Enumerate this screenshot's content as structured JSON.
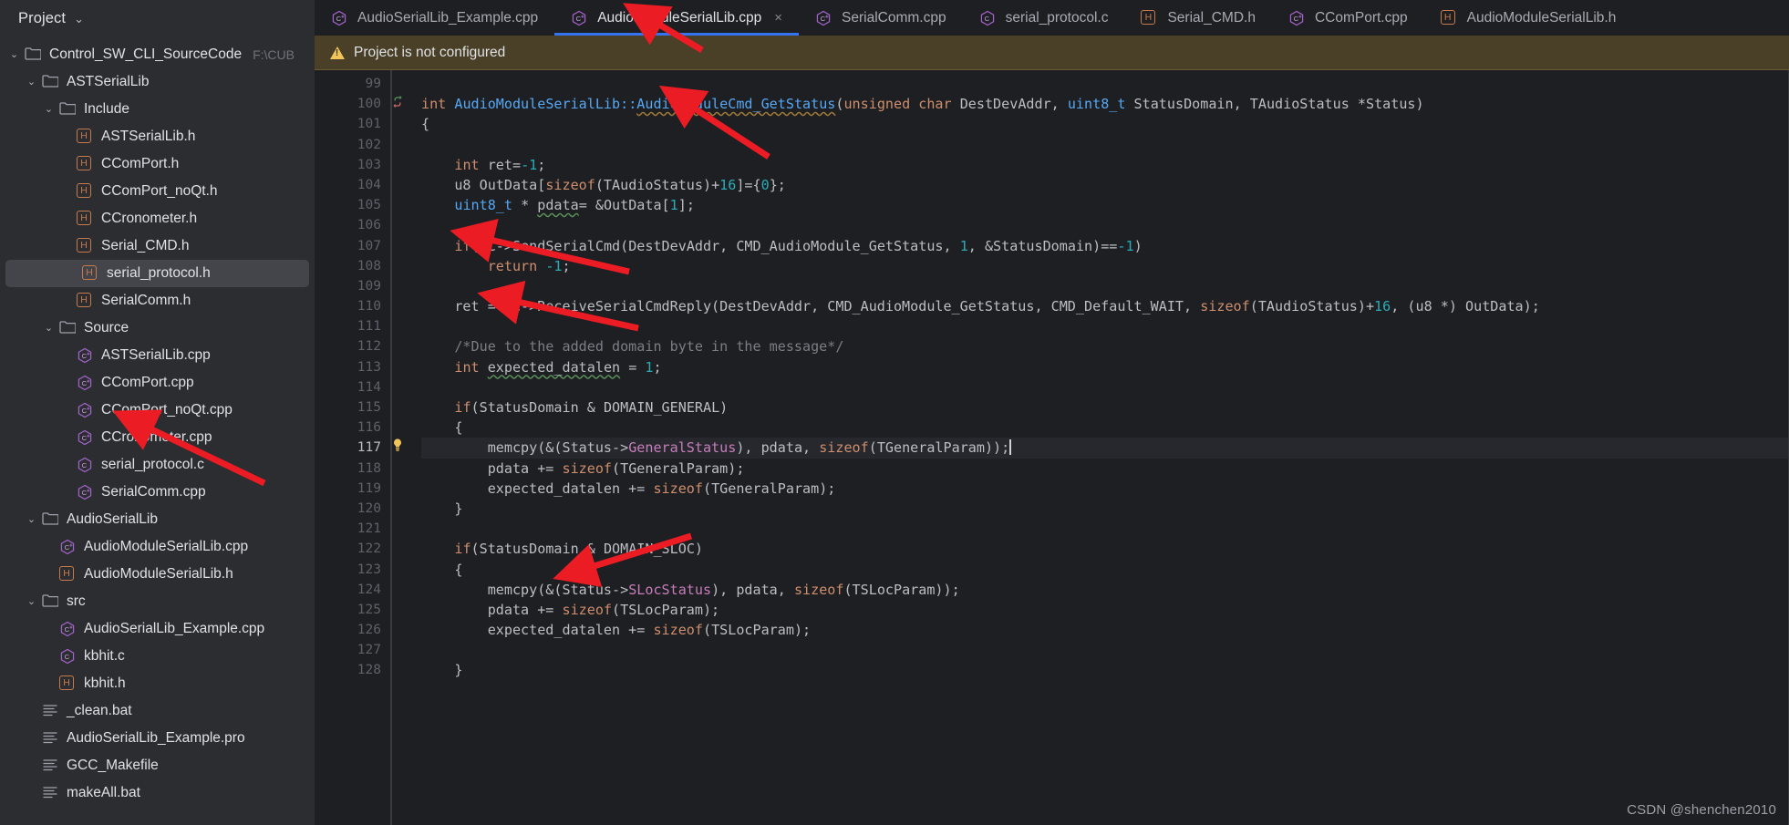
{
  "sidebar": {
    "title": "Project",
    "chevron": "⌄",
    "root_path": "F:\\CUB",
    "items": [
      {
        "label": "Control_SW_CLI_SourceCode",
        "icon": "folder-icon",
        "depth": 0,
        "twist": "⌄",
        "path": "F:\\CUB"
      },
      {
        "label": "ASTSerialLib",
        "icon": "folder-icon",
        "depth": 1,
        "twist": "⌄"
      },
      {
        "label": "Include",
        "icon": "folder-icon",
        "depth": 2,
        "twist": "⌄"
      },
      {
        "label": "ASTSerialLib.h",
        "icon": "header-file-icon",
        "depth": 3,
        "twist": ""
      },
      {
        "label": "CComPort.h",
        "icon": "header-file-icon",
        "depth": 3,
        "twist": ""
      },
      {
        "label": "CComPort_noQt.h",
        "icon": "header-file-icon",
        "depth": 3,
        "twist": ""
      },
      {
        "label": "CCronometer.h",
        "icon": "header-file-icon",
        "depth": 3,
        "twist": ""
      },
      {
        "label": "Serial_CMD.h",
        "icon": "header-file-icon",
        "depth": 3,
        "twist": ""
      },
      {
        "label": "serial_protocol.h",
        "icon": "header-file-icon",
        "depth": 3,
        "twist": "",
        "selected": true
      },
      {
        "label": "SerialComm.h",
        "icon": "header-file-icon",
        "depth": 3,
        "twist": ""
      },
      {
        "label": "Source",
        "icon": "folder-icon",
        "depth": 2,
        "twist": "⌄"
      },
      {
        "label": "ASTSerialLib.cpp",
        "icon": "cpp-file-icon",
        "depth": 3,
        "twist": ""
      },
      {
        "label": "CComPort.cpp",
        "icon": "cpp-file-icon",
        "depth": 3,
        "twist": ""
      },
      {
        "label": "CComPort_noQt.cpp",
        "icon": "cpp-file-icon",
        "depth": 3,
        "twist": ""
      },
      {
        "label": "CCronometer.cpp",
        "icon": "cpp-file-icon",
        "depth": 3,
        "twist": ""
      },
      {
        "label": "serial_protocol.c",
        "icon": "c-file-icon",
        "depth": 3,
        "twist": ""
      },
      {
        "label": "SerialComm.cpp",
        "icon": "cpp-file-icon",
        "depth": 3,
        "twist": ""
      },
      {
        "label": "AudioSerialLib",
        "icon": "folder-icon",
        "depth": 1,
        "twist": "⌄"
      },
      {
        "label": "AudioModuleSerialLib.cpp",
        "icon": "cpp-file-icon",
        "depth": 2,
        "twist": ""
      },
      {
        "label": "AudioModuleSerialLib.h",
        "icon": "header-file-icon",
        "depth": 2,
        "twist": ""
      },
      {
        "label": "src",
        "icon": "folder-icon",
        "depth": 1,
        "twist": "⌄"
      },
      {
        "label": "AudioSerialLib_Example.cpp",
        "icon": "cpp-file-icon",
        "depth": 2,
        "twist": ""
      },
      {
        "label": "kbhit.c",
        "icon": "c-file-icon",
        "depth": 2,
        "twist": ""
      },
      {
        "label": "kbhit.h",
        "icon": "header-file-icon",
        "depth": 2,
        "twist": ""
      },
      {
        "label": "_clean.bat",
        "icon": "text-file-icon",
        "depth": 1,
        "twist": ""
      },
      {
        "label": "AudioSerialLib_Example.pro",
        "icon": "text-file-icon",
        "depth": 1,
        "twist": ""
      },
      {
        "label": "GCC_Makefile",
        "icon": "text-file-icon",
        "depth": 1,
        "twist": ""
      },
      {
        "label": "makeAll.bat",
        "icon": "text-file-icon",
        "depth": 1,
        "twist": ""
      }
    ]
  },
  "tabs": [
    {
      "label": "AudioSerialLib_Example.cpp",
      "icon": "cpp-file-icon",
      "active": false
    },
    {
      "label": "AudioModuleSerialLib.cpp",
      "icon": "cpp-file-icon",
      "active": true,
      "close": "×"
    },
    {
      "label": "SerialComm.cpp",
      "icon": "cpp-file-icon",
      "active": false
    },
    {
      "label": "serial_protocol.c",
      "icon": "c-file-icon",
      "active": false
    },
    {
      "label": "Serial_CMD.h",
      "icon": "header-file-icon",
      "active": false
    },
    {
      "label": "CComPort.cpp",
      "icon": "cpp-file-icon",
      "active": false
    },
    {
      "label": "AudioModuleSerialLib.h",
      "icon": "header-file-icon",
      "active": false
    }
  ],
  "notification": {
    "icon": "warning-triangle-icon",
    "text": "Project is not configured"
  },
  "editor": {
    "first_line": 99,
    "current_line": 117,
    "lines": [
      {
        "n": 99,
        "tokens": []
      },
      {
        "n": 100,
        "marker": "method-return-icon",
        "tokens": [
          {
            "t": "int ",
            "c": "kw"
          },
          {
            "t": "AudioModuleSerialLib::",
            "c": "fn"
          },
          {
            "t": "AudioModuleCmd_GetStatus",
            "c": "fn undl squiggle"
          },
          {
            "t": "(",
            "c": "def"
          },
          {
            "t": "unsigned char ",
            "c": "kw"
          },
          {
            "t": "DestDevAddr, ",
            "c": "def"
          },
          {
            "t": "uint8_t ",
            "c": "fn"
          },
          {
            "t": "StatusDomain, TAudioStatus *Status)",
            "c": "def"
          }
        ]
      },
      {
        "n": 101,
        "tokens": [
          {
            "t": "{",
            "c": "def"
          }
        ]
      },
      {
        "n": 102,
        "tokens": []
      },
      {
        "n": 103,
        "tokens": [
          {
            "t": "    ",
            "c": "def"
          },
          {
            "t": "int ",
            "c": "kw"
          },
          {
            "t": "ret=",
            "c": "def"
          },
          {
            "t": "-1",
            "c": "num"
          },
          {
            "t": ";",
            "c": "def"
          }
        ]
      },
      {
        "n": 104,
        "tokens": [
          {
            "t": "    u8 OutData[",
            "c": "def"
          },
          {
            "t": "sizeof",
            "c": "kw"
          },
          {
            "t": "(TAudioStatus)+",
            "c": "def"
          },
          {
            "t": "16",
            "c": "num"
          },
          {
            "t": "]={",
            "c": "def"
          },
          {
            "t": "0",
            "c": "num"
          },
          {
            "t": "};",
            "c": "def"
          }
        ]
      },
      {
        "n": 105,
        "tokens": [
          {
            "t": "    ",
            "c": "def"
          },
          {
            "t": "uint8_t ",
            "c": "fn"
          },
          {
            "t": "* ",
            "c": "def"
          },
          {
            "t": "pdata",
            "c": "def squiggle-g"
          },
          {
            "t": "= &OutData[",
            "c": "def"
          },
          {
            "t": "1",
            "c": "num"
          },
          {
            "t": "];",
            "c": "def"
          }
        ]
      },
      {
        "n": 106,
        "tokens": []
      },
      {
        "n": 107,
        "tokens": [
          {
            "t": "    ",
            "c": "def"
          },
          {
            "t": "if",
            "c": "kw"
          },
          {
            "t": "(SC->SendSerialCmd(DestDevAddr, CMD_AudioModule_GetStatus, ",
            "c": "def"
          },
          {
            "t": "1",
            "c": "num"
          },
          {
            "t": ", &StatusDomain)==",
            "c": "def"
          },
          {
            "t": "-1",
            "c": "num"
          },
          {
            "t": ")",
            "c": "def"
          }
        ]
      },
      {
        "n": 108,
        "tokens": [
          {
            "t": "        ",
            "c": "def"
          },
          {
            "t": "return ",
            "c": "kw"
          },
          {
            "t": "-1",
            "c": "num"
          },
          {
            "t": ";",
            "c": "def"
          }
        ]
      },
      {
        "n": 109,
        "tokens": []
      },
      {
        "n": 110,
        "tokens": [
          {
            "t": "    ret = SC->ReceiveSerialCmdReply(DestDevAddr, CMD_AudioModule_GetStatus, CMD_Default_WAIT, ",
            "c": "def"
          },
          {
            "t": "sizeof",
            "c": "kw"
          },
          {
            "t": "(TAudioStatus)+",
            "c": "def"
          },
          {
            "t": "16",
            "c": "num"
          },
          {
            "t": ", (u8 *) OutData);",
            "c": "def"
          }
        ]
      },
      {
        "n": 111,
        "tokens": []
      },
      {
        "n": 112,
        "tokens": [
          {
            "t": "    /*Due to the added domain byte in the message*/",
            "c": "cmt"
          }
        ]
      },
      {
        "n": 113,
        "tokens": [
          {
            "t": "    ",
            "c": "def"
          },
          {
            "t": "int ",
            "c": "kw"
          },
          {
            "t": "expected_datalen",
            "c": "def squiggle-g"
          },
          {
            "t": " = ",
            "c": "def"
          },
          {
            "t": "1",
            "c": "num"
          },
          {
            "t": ";",
            "c": "def"
          }
        ]
      },
      {
        "n": 114,
        "tokens": []
      },
      {
        "n": 115,
        "tokens": [
          {
            "t": "    ",
            "c": "def"
          },
          {
            "t": "if",
            "c": "kw"
          },
          {
            "t": "(StatusDomain & DOMAIN_GENERAL)",
            "c": "def"
          }
        ]
      },
      {
        "n": 116,
        "tokens": [
          {
            "t": "    {",
            "c": "def"
          }
        ]
      },
      {
        "n": 117,
        "marker": "lightbulb-icon",
        "highlight": true,
        "caret": true,
        "tokens": [
          {
            "t": "        memcpy(&(Status->",
            "c": "def"
          },
          {
            "t": "GeneralStatus",
            "c": "fld"
          },
          {
            "t": "), pdata, ",
            "c": "def"
          },
          {
            "t": "sizeof",
            "c": "kw"
          },
          {
            "t": "(TGeneralParam));",
            "c": "def"
          }
        ]
      },
      {
        "n": 118,
        "tokens": [
          {
            "t": "        pdata += ",
            "c": "def"
          },
          {
            "t": "sizeof",
            "c": "kw"
          },
          {
            "t": "(TGeneralParam);",
            "c": "def"
          }
        ]
      },
      {
        "n": 119,
        "tokens": [
          {
            "t": "        expected_datalen += ",
            "c": "def"
          },
          {
            "t": "sizeof",
            "c": "kw"
          },
          {
            "t": "(TGeneralParam);",
            "c": "def"
          }
        ]
      },
      {
        "n": 120,
        "tokens": [
          {
            "t": "    }",
            "c": "def"
          }
        ]
      },
      {
        "n": 121,
        "tokens": []
      },
      {
        "n": 122,
        "tokens": [
          {
            "t": "    ",
            "c": "def"
          },
          {
            "t": "if",
            "c": "kw"
          },
          {
            "t": "(StatusDomain & DOMAIN_SLOC)",
            "c": "def"
          }
        ]
      },
      {
        "n": 123,
        "tokens": [
          {
            "t": "    {",
            "c": "def"
          }
        ]
      },
      {
        "n": 124,
        "tokens": [
          {
            "t": "        memcpy(&(Status->",
            "c": "def"
          },
          {
            "t": "SLocStatus",
            "c": "fld"
          },
          {
            "t": "), pdata, ",
            "c": "def"
          },
          {
            "t": "sizeof",
            "c": "kw"
          },
          {
            "t": "(TSLocParam));",
            "c": "def"
          }
        ]
      },
      {
        "n": 125,
        "tokens": [
          {
            "t": "        pdata += ",
            "c": "def"
          },
          {
            "t": "sizeof",
            "c": "kw"
          },
          {
            "t": "(TSLocParam);",
            "c": "def"
          }
        ]
      },
      {
        "n": 126,
        "tokens": [
          {
            "t": "        expected_datalen += ",
            "c": "def"
          },
          {
            "t": "sizeof",
            "c": "kw"
          },
          {
            "t": "(TSLocParam);",
            "c": "def"
          }
        ]
      },
      {
        "n": 127,
        "tokens": []
      },
      {
        "n": 128,
        "tokens": [
          {
            "t": "    }",
            "c": "def"
          }
        ]
      }
    ]
  },
  "watermark": "CSDN @shenchen2010",
  "colors": {
    "accent": "#3574f0",
    "warning_bg": "#4a3f27",
    "sidebar_bg": "#2b2d30",
    "editor_bg": "#1e1f22",
    "arrow": "#ec1c24"
  }
}
